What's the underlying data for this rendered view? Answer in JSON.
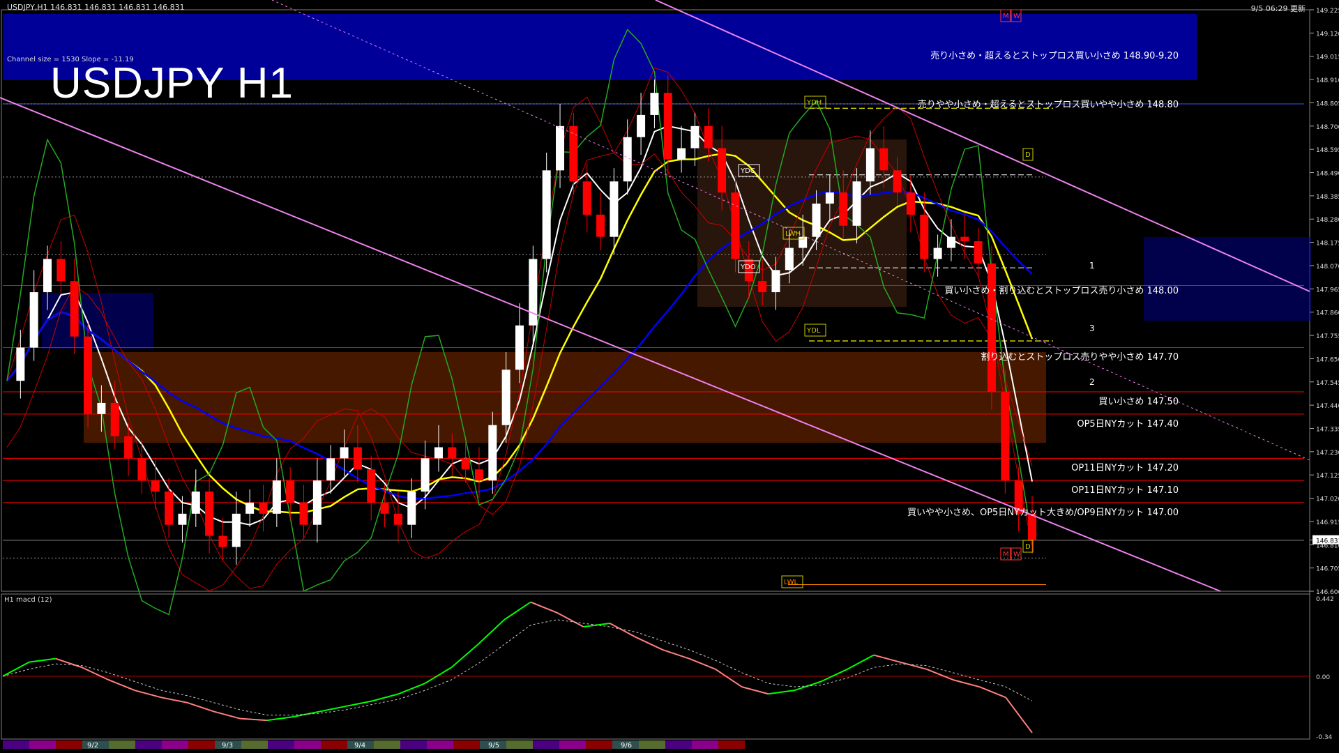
{
  "header": {
    "symbol_info": "USDJPY,H1  146.831 146.831 146.831 146.831",
    "timestamp": "9/5 06:29 更新",
    "big_title": "USDJPY H1",
    "channel_info": "Channel size = 1530 Slope = -11.19",
    "macd_label": "H1  macd (12)"
  },
  "annotations": [
    {
      "text": "売り小さめ・超えるとストップロス買い小さめ 148.90-9.20",
      "price": 149.02
    },
    {
      "text": "売りやや小さめ・超えるとストップロス買いやや小さめ 148.80",
      "price": 148.8
    },
    {
      "text": "買い小さめ・割り込むとストップロス売り小さめ 148.00",
      "price": 147.96
    },
    {
      "text": "割り込むとストップロス売りやや小さめ 147.70",
      "price": 147.66
    },
    {
      "text": "買い小さめ 147.50",
      "price": 147.46
    },
    {
      "text": "OP5日NYカット 147.40",
      "price": 147.36
    },
    {
      "text": "OP11日NYカット 147.20",
      "price": 147.16
    },
    {
      "text": "OP11日NYカット 147.10",
      "price": 147.06
    },
    {
      "text": "買いやや小さめ、OP5日NYカット大きめ/OP9日NYカット 147.00",
      "price": 146.96
    }
  ],
  "level_labels": [
    {
      "text": "YDH",
      "price": 148.78
    },
    {
      "text": "YDC",
      "price": 148.44
    },
    {
      "text": "YDO",
      "price": 148.04
    },
    {
      "text": "LWH",
      "price": 148.15
    },
    {
      "text": "YDL",
      "price": 147.73
    },
    {
      "text": "LWL",
      "price": 146.63
    },
    {
      "text": "D",
      "price": 148.53
    },
    {
      "text": "D",
      "price": 146.85
    },
    {
      "text": "M",
      "price": 149.2
    },
    {
      "text": "W",
      "price": 149.2
    },
    {
      "text": "M",
      "price": 146.76
    },
    {
      "text": "W",
      "price": 146.76
    }
  ],
  "channel_markers": [
    "1",
    "2",
    "3"
  ],
  "colors": {
    "background": "#000000",
    "bull_candle": "#ffffff",
    "bear_candle": "#ff0000",
    "resistance_zone": "#000099",
    "support_line": "#ff0000",
    "channel": "#ee82ee",
    "ma_fast": "#ffffff",
    "ma_mid": "#ffff00",
    "ma_slow": "#0000ff",
    "macd_up": "#00ff00",
    "macd_down": "#ff8080"
  },
  "chart_data": [
    {
      "type": "candlestick",
      "title": "USDJPY H1",
      "ylim": [
        146.6,
        149.225
      ],
      "y_ticks": [
        "149.225",
        "149.120",
        "149.015",
        "148.910",
        "148.805",
        "148.700",
        "148.595",
        "148.490",
        "148.385",
        "148.280",
        "148.175",
        "148.070",
        "147.965",
        "147.860",
        "147.755",
        "147.650",
        "147.545",
        "147.440",
        "147.335",
        "147.230",
        "147.125",
        "147.020",
        "146.915",
        "146.831",
        "146.810",
        "146.705",
        "146.600"
      ],
      "current_price": "146.831",
      "x_labels": [
        "9/2",
        "9/3",
        "9/4",
        "9/5",
        "9/6"
      ],
      "close_path": [
        147.55,
        147.7,
        147.95,
        148.1,
        148.0,
        147.75,
        147.4,
        147.45,
        147.3,
        147.2,
        147.1,
        147.05,
        146.9,
        146.95,
        147.05,
        146.85,
        146.8,
        146.95,
        147.0,
        146.95,
        147.1,
        147.0,
        146.9,
        147.1,
        147.2,
        147.25,
        147.15,
        147.0,
        146.95,
        146.9,
        147.05,
        147.2,
        147.25,
        147.2,
        147.15,
        147.1,
        147.35,
        147.6,
        147.8,
        148.1,
        148.5,
        148.7,
        148.45,
        148.3,
        148.2,
        148.45,
        148.65,
        148.75,
        148.85,
        148.55,
        148.6,
        148.7,
        148.6,
        148.4,
        148.1,
        148.0,
        147.95,
        148.05,
        148.15,
        148.2,
        148.35,
        148.4,
        148.25,
        148.45,
        148.6,
        148.5,
        148.4,
        148.3,
        148.1,
        148.15,
        148.2,
        148.18,
        148.08,
        147.5,
        147.1,
        146.95,
        146.83
      ],
      "grid": false
    },
    {
      "type": "line",
      "title": "macd (12)",
      "ylim": [
        -0.34,
        0.442
      ],
      "y_ticks": [
        "0.442",
        "0.00",
        "-0.34"
      ],
      "series": [
        {
          "name": "macd",
          "values": [
            0.0,
            0.08,
            0.1,
            0.05,
            -0.02,
            -0.08,
            -0.12,
            -0.15,
            -0.2,
            -0.24,
            -0.25,
            -0.23,
            -0.2,
            -0.17,
            -0.14,
            -0.1,
            -0.04,
            0.05,
            0.18,
            0.32,
            0.42,
            0.36,
            0.28,
            0.3,
            0.22,
            0.15,
            0.1,
            0.04,
            -0.06,
            -0.1,
            -0.08,
            -0.03,
            0.04,
            0.12,
            0.08,
            0.04,
            -0.02,
            -0.06,
            -0.12,
            -0.32
          ]
        },
        {
          "name": "signal",
          "values": [
            0.0,
            0.04,
            0.07,
            0.06,
            0.02,
            -0.03,
            -0.08,
            -0.11,
            -0.15,
            -0.19,
            -0.22,
            -0.22,
            -0.21,
            -0.19,
            -0.16,
            -0.13,
            -0.08,
            -0.02,
            0.07,
            0.18,
            0.29,
            0.32,
            0.3,
            0.28,
            0.25,
            0.2,
            0.15,
            0.09,
            0.02,
            -0.04,
            -0.06,
            -0.05,
            -0.01,
            0.05,
            0.07,
            0.06,
            0.02,
            -0.02,
            -0.06,
            -0.14
          ]
        }
      ]
    }
  ]
}
